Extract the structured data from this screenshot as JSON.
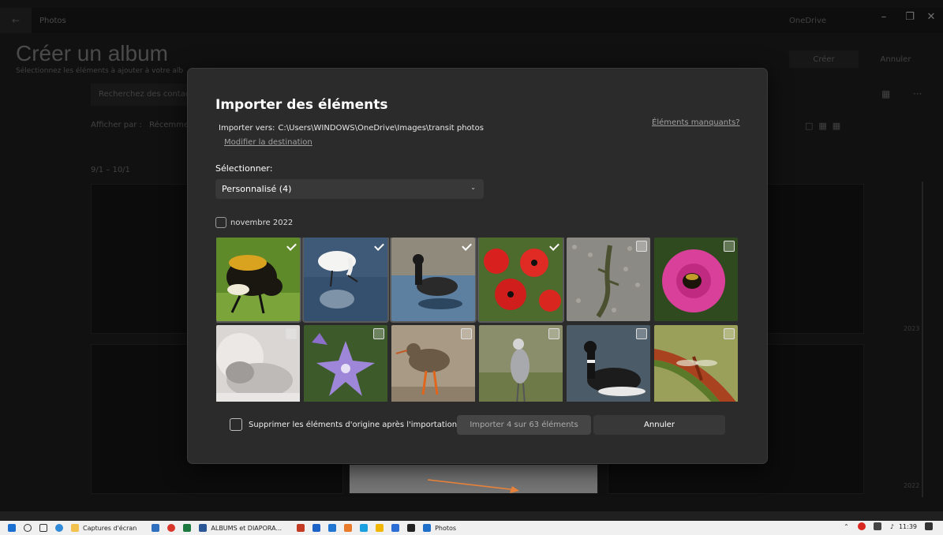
{
  "window": {
    "app_name": "Photos",
    "back_icon": "back-arrow-icon",
    "onedrive_label": "OneDrive",
    "minimize": "–",
    "maximize": "❐",
    "close": "✕"
  },
  "background": {
    "title": "Créer un album",
    "subtitle": "Sélectionnez les éléments à ajouter à votre alb",
    "create_button": "Créer",
    "cancel_button": "Annuler",
    "search_placeholder": "Recherchez des contact",
    "view_by_label": "Afficher par :",
    "view_by_value": "Récemmen",
    "date_range": "9/1 – 10/1",
    "year_2023": "2023",
    "year_2022": "2022"
  },
  "dialog": {
    "title": "Importer des éléments",
    "destination_label": "Importer vers:",
    "destination_path": "C:\\Users\\WINDOWS\\OneDrive\\Images\\transit photos",
    "change_destination": "Modifier la destination",
    "missing_items": "Éléments manquants?",
    "select_label": "Sélectionner:",
    "select_value": "Personnalisé (4)",
    "month_group": "novembre 2022",
    "photos": [
      {
        "subject": "bumblebee",
        "selected": true
      },
      {
        "subject": "egret",
        "selected": true
      },
      {
        "subject": "brant goose",
        "selected": true
      },
      {
        "subject": "red poppies",
        "selected": true
      },
      {
        "subject": "lizard on gravel",
        "selected": false
      },
      {
        "subject": "pink mallow with bee",
        "selected": false
      },
      {
        "subject": "sleeping baby",
        "selected": false
      },
      {
        "subject": "purple bellflower",
        "selected": false
      },
      {
        "subject": "redshank",
        "selected": false
      },
      {
        "subject": "grey heron",
        "selected": false
      },
      {
        "subject": "brant goose swimming",
        "selected": false
      },
      {
        "subject": "dragonfly on leaf",
        "selected": false
      }
    ],
    "delete_originals_label": "Supprimer les éléments d'origine après l'importation",
    "import_button": "Importer 4 sur 63 éléments",
    "cancel_button": "Annuler"
  },
  "taskbar": {
    "item_screenshots": "Captures d'écran",
    "item_albums": "ALBUMS et DIAPORA...",
    "item_photos": "Photos",
    "time": "11:39"
  },
  "colors": {
    "dialog_bg": "#2b2b2b",
    "accent_arrow": "#e8823a"
  }
}
